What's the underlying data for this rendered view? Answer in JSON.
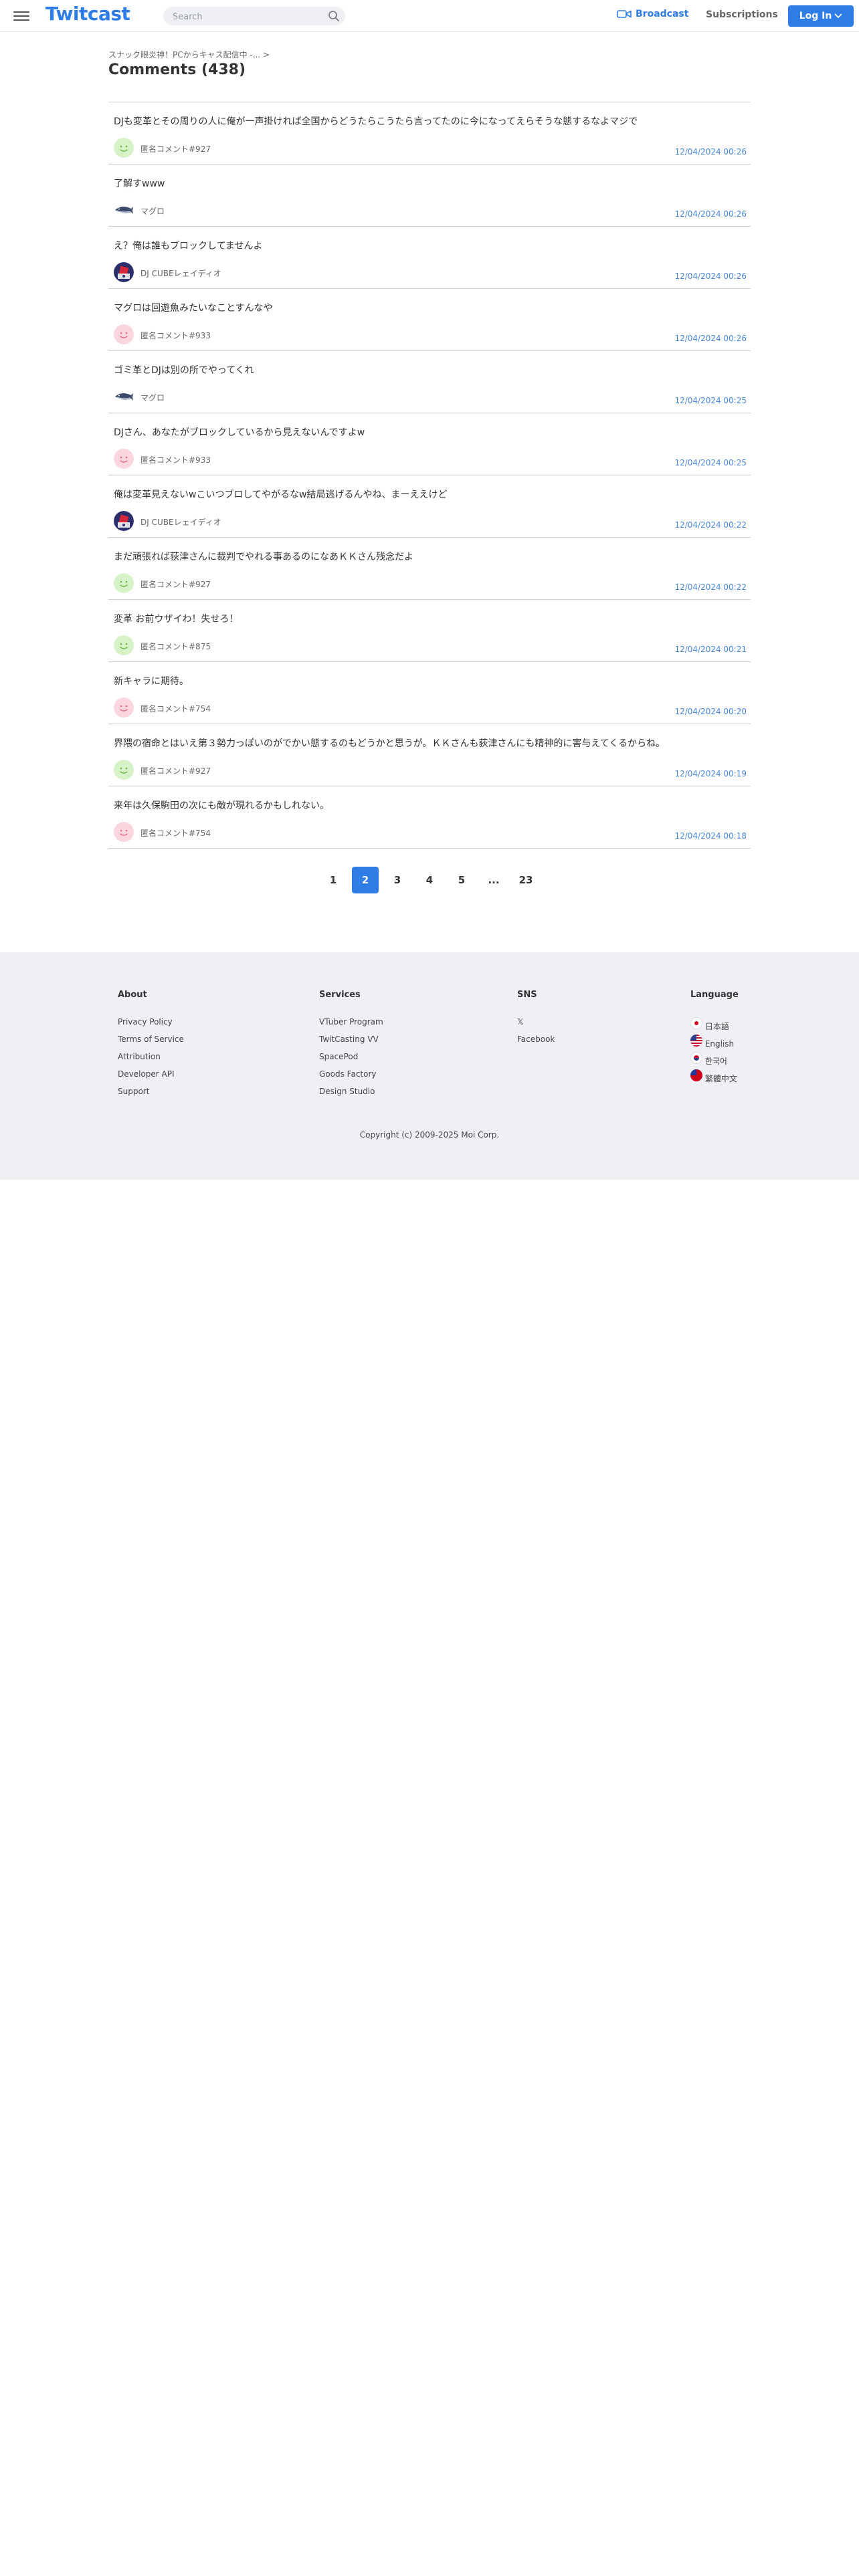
{
  "header": {
    "logo": "Twitcast",
    "search_placeholder": "Search",
    "broadcast_label": "Broadcast",
    "subscriptions_label": "Subscriptions",
    "login_label": "Log In",
    "brand_color": "#2e7ce6"
  },
  "breadcrumb": "スナック眼炎神！PCからキャス配信中 -...  >",
  "page_title": "Comments (438)",
  "comments": [
    {
      "text": "DJも変革とその周りの人に俺が一声掛ければ全国からどうたらこうたら言ってたのに今になってえらそうな態するなよマジで",
      "user": "匿名コメント#927",
      "time": "12/04/2024 00:26",
      "avatar": "green-smile-icon"
    },
    {
      "text": "了解すwww",
      "user": "マグロ",
      "time": "12/04/2024 00:26",
      "avatar": "tuna-icon"
    },
    {
      "text": "え？俺は誰もブロックしてませんよ",
      "user": "DJ CUBEレェイディオ",
      "time": "12/04/2024 00:26",
      "avatar": "dj-cube-icon"
    },
    {
      "text": "マグロは回遊魚みたいなことすんなや",
      "user": "匿名コメント#933",
      "time": "12/04/2024 00:26",
      "avatar": "pink-smile-icon"
    },
    {
      "text": "ゴミ革とDJは別の所でやってくれ",
      "user": "マグロ",
      "time": "12/04/2024 00:25",
      "avatar": "tuna-icon"
    },
    {
      "text": "DJさん、あなたがブロックしているから見えないんですよw",
      "user": "匿名コメント#933",
      "time": "12/04/2024 00:25",
      "avatar": "pink-smile-icon"
    },
    {
      "text": "俺は変革見えないwこいつブロしてやがるなw結局逃げるんやね、まーええけど",
      "user": "DJ CUBEレェイディオ",
      "time": "12/04/2024 00:22",
      "avatar": "dj-cube-icon"
    },
    {
      "text": "まだ頑張れば荻津さんに裁判でやれる事あるのになあＫＫさん残念だよ",
      "user": "匿名コメント#927",
      "time": "12/04/2024 00:22",
      "avatar": "green-smile-icon"
    },
    {
      "text": "変革 お前ウザイわ！失せろ！",
      "user": "匿名コメント#875",
      "time": "12/04/2024 00:21",
      "avatar": "green-smile-icon"
    },
    {
      "text": "新キャラに期待。",
      "user": "匿名コメント#754",
      "time": "12/04/2024 00:20",
      "avatar": "pink-smile-icon"
    },
    {
      "text": "界隈の宿命とはいえ第３勢力っぽいのがでかい態するのもどうかと思うが。ＫＫさんも荻津さんにも精神的に害与えてくるからね。",
      "user": "匿名コメント#927",
      "time": "12/04/2024 00:19",
      "avatar": "green-smile-icon"
    },
    {
      "text": "来年は久保駒田の次にも敵が現れるかもしれない。",
      "user": "匿名コメント#754",
      "time": "12/04/2024 00:18",
      "avatar": "pink-smile-icon"
    }
  ],
  "pagination": {
    "pages": [
      "1",
      "2",
      "3",
      "4",
      "5",
      "...",
      "23"
    ],
    "active": "2"
  },
  "footer": {
    "about": {
      "heading": "About",
      "links": [
        "Privacy Policy",
        "Terms of Service",
        "Attribution",
        "Developer API",
        "Support"
      ]
    },
    "services": {
      "heading": "Services",
      "links": [
        "VTuber Program",
        "TwitCasting VV",
        "SpacePod",
        "Goods Factory",
        "Design Studio"
      ]
    },
    "sns": {
      "heading": "SNS",
      "links": [
        "𝕏",
        "Facebook"
      ]
    },
    "language": {
      "heading": "Language",
      "items": [
        {
          "label": "日本語",
          "flag": "japan-flag-icon"
        },
        {
          "label": "English",
          "flag": "us-flag-icon"
        },
        {
          "label": "한국어",
          "flag": "korea-flag-icon"
        },
        {
          "label": "繁體中文",
          "flag": "taiwan-flag-icon"
        }
      ]
    },
    "copyright": "Copyright (c) 2009-2025 Moi Corp."
  }
}
